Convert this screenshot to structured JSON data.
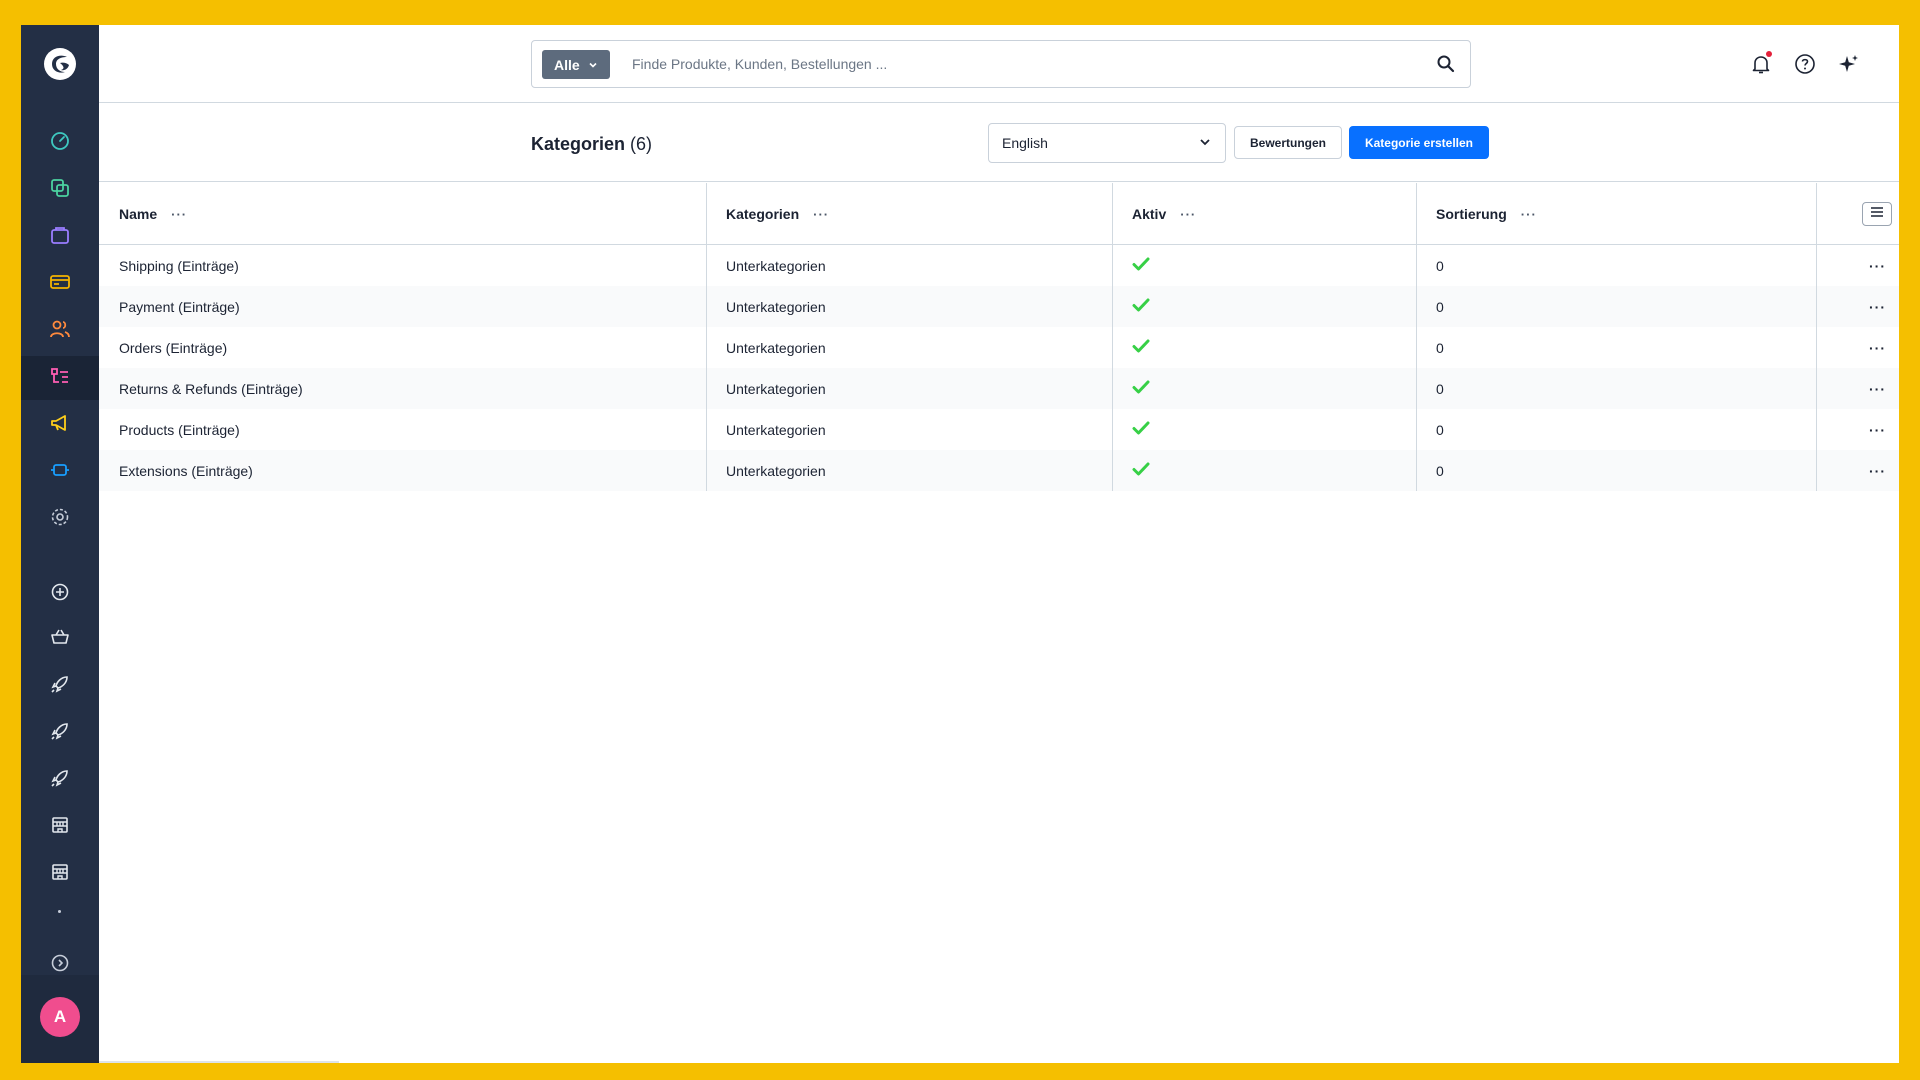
{
  "app": {
    "accent": "#0870ff",
    "sidebar_bg": "#232f45",
    "check_color": "#37d046"
  },
  "sidebar": {
    "items": [
      {
        "name": "dashboard-icon",
        "color": "#3ec9c0"
      },
      {
        "name": "catalogue-icon",
        "color": "#4bd3a0"
      },
      {
        "name": "orders-icon",
        "color": "#9a7dff"
      },
      {
        "name": "payment-icon",
        "color": "#f5b400"
      },
      {
        "name": "customers-icon",
        "color": "#ff8a3d"
      },
      {
        "name": "content-icon",
        "color": "#ff5eb3"
      },
      {
        "name": "marketing-icon",
        "color": "#ffcf1a"
      },
      {
        "name": "extensions-icon",
        "color": "#189eff"
      },
      {
        "name": "settings-icon",
        "color": "#c7ceda"
      }
    ],
    "avatar_initial": "A"
  },
  "search": {
    "type_label": "Alle",
    "placeholder": "Finde Produkte, Kunden, Bestellungen ..."
  },
  "page": {
    "title": "Kategorien",
    "count": "(6)",
    "language": "English",
    "reviews_button": "Bewertungen",
    "create_button": "Kategorie erstellen"
  },
  "grid": {
    "columns": {
      "name": "Name",
      "categories": "Kategorien",
      "active": "Aktiv",
      "position": "Sortierung"
    },
    "column_menu": "···",
    "rows": [
      {
        "name": "Shipping (Einträge)",
        "categories": "Unterkategorien",
        "active": true,
        "position": "0"
      },
      {
        "name": "Payment (Einträge)",
        "categories": "Unterkategorien",
        "active": true,
        "position": "0"
      },
      {
        "name": "Orders (Einträge)",
        "categories": "Unterkategorien",
        "active": true,
        "position": "0"
      },
      {
        "name": "Returns & Refunds (Einträge)",
        "categories": "Unterkategorien",
        "active": true,
        "position": "0"
      },
      {
        "name": "Products (Einträge)",
        "categories": "Unterkategorien",
        "active": true,
        "position": "0"
      },
      {
        "name": "Extensions (Einträge)",
        "categories": "Unterkategorien",
        "active": true,
        "position": "0"
      }
    ],
    "row_menu": "···"
  }
}
